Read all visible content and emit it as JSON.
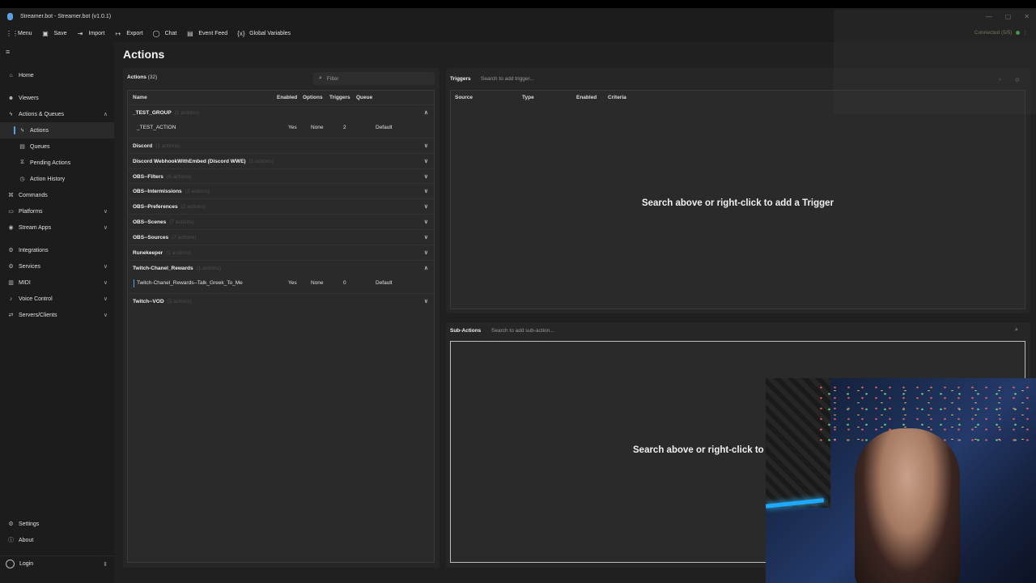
{
  "window": {
    "title": "Streamer.bot - Streamer.bot (v1.0.1)",
    "controls": [
      "minimize-icon",
      "restore-icon",
      "close-icon"
    ]
  },
  "menubar": {
    "items": [
      {
        "label": "Menu",
        "icon": "grid-icon"
      },
      {
        "label": "Save",
        "icon": "save-icon"
      },
      {
        "label": "Import",
        "icon": "import-icon"
      },
      {
        "label": "Export",
        "icon": "export-icon"
      },
      {
        "label": "Chat",
        "icon": "chat-icon"
      },
      {
        "label": "Event Feed",
        "icon": "event-feed-icon"
      },
      {
        "label": "Global Variables",
        "icon": "variables-icon"
      }
    ],
    "connection": "Connected (5/5)",
    "connection_color": "#4caf50"
  },
  "sidebar": {
    "home": "Home",
    "viewers": "Viewers",
    "actions_queues": "Actions & Queues",
    "actions": "Actions",
    "queues": "Queues",
    "pending_actions": "Pending Actions",
    "action_history": "Action History",
    "commands": "Commands",
    "platforms": "Platforms",
    "stream_apps": "Stream Apps",
    "integrations": "Integrations",
    "services": "Services",
    "midi": "MIDI",
    "voice_control": "Voice Control",
    "servers_clients": "Servers/Clients",
    "settings": "Settings",
    "about": "About",
    "login": "Login"
  },
  "page": {
    "title": "Actions"
  },
  "actions_panel": {
    "header": "Actions",
    "count": "(32)",
    "filter_placeholder": "Filter",
    "columns": [
      "Name",
      "Enabled",
      "Options",
      "Triggers",
      "Queue"
    ],
    "groups": [
      {
        "name": "_TEST_GROUP",
        "count": "(1 actions)",
        "expanded": true
      },
      {
        "name": "Discord",
        "count": "(1 actions)",
        "expanded": false
      },
      {
        "name": "Discord WebhookWithEmbed (Discord WWE)",
        "count": "(1 actions)",
        "expanded": false
      },
      {
        "name": "OBS--Filters",
        "count": "(6 actions)",
        "expanded": false
      },
      {
        "name": "OBS--Intermissions",
        "count": "(2 actions)",
        "expanded": false
      },
      {
        "name": "OBS--Preferences",
        "count": "(2 actions)",
        "expanded": false
      },
      {
        "name": "OBS--Scenes",
        "count": "(7 actions)",
        "expanded": false
      },
      {
        "name": "OBS--Sources",
        "count": "(7 actions)",
        "expanded": false
      },
      {
        "name": "Runekeeper",
        "count": "(1 actions)",
        "expanded": false
      },
      {
        "name": "Twitch-Chanel_Rewards",
        "count": "(1 actions)",
        "expanded": true
      },
      {
        "name": "Twitch--VOD",
        "count": "(3 actions)",
        "expanded": false
      }
    ],
    "actions": [
      {
        "name": "_TEST_ACTION",
        "enabled": "Yes",
        "options": "None",
        "triggers": "2",
        "queue": "Default"
      },
      {
        "name": "Twitch-Chanel_Rewards--Talk_Greek_To_Me",
        "enabled": "Yes",
        "options": "None",
        "triggers": "0",
        "queue": "Default"
      }
    ]
  },
  "triggers_panel": {
    "header": "Triggers",
    "search_placeholder": "Search to add trigger...",
    "columns": [
      "Source",
      "Type",
      "Enabled",
      "Criteria"
    ],
    "empty_message": "Search above or right-click to add a Trigger"
  },
  "subactions_panel": {
    "header": "Sub-Actions",
    "search_placeholder": "Search to add sub-action...",
    "empty_message": "Search above or right-click to"
  }
}
